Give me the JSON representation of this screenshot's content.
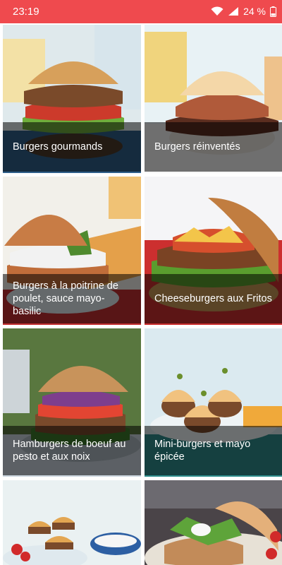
{
  "status": {
    "time": "23:19",
    "battery": "24 %"
  },
  "colors": {
    "statusbar": "#ef4a4e"
  },
  "cards": [
    {
      "title": "Burgers gourmands",
      "photo": "burger-photo"
    },
    {
      "title": "Burgers réinventés",
      "photo": "burger-photo"
    },
    {
      "title": "Burgers à la poitrine de poulet, sauce mayo-basilic",
      "photo": "burger-photo"
    },
    {
      "title": "Cheeseburgers aux Fritos",
      "photo": "burger-photo"
    },
    {
      "title": "Hamburgers de boeuf au pesto et aux noix",
      "photo": "burger-photo"
    },
    {
      "title": "Mini-burgers et mayo épicée",
      "photo": "burger-photo"
    },
    {
      "title": "",
      "photo": "burger-photo"
    },
    {
      "title": "",
      "photo": "burger-photo"
    }
  ]
}
